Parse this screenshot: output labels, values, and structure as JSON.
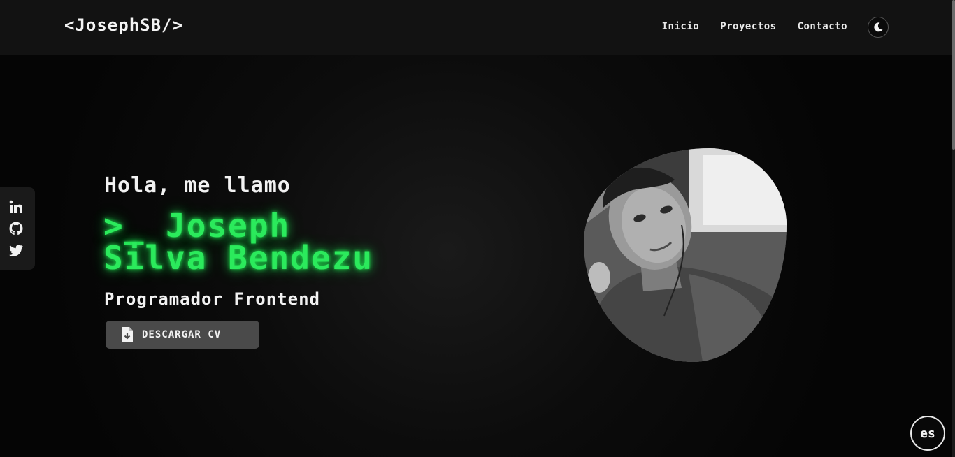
{
  "header": {
    "logo": "<JosephSB/>",
    "nav": [
      {
        "label": "Inicio"
      },
      {
        "label": "Proyectos"
      },
      {
        "label": "Contacto"
      }
    ],
    "theme_toggle_icon": "moon-icon"
  },
  "social": [
    {
      "icon": "linkedin-icon"
    },
    {
      "icon": "github-icon"
    },
    {
      "icon": "twitter-icon"
    }
  ],
  "hero": {
    "greeting": "Hola, me llamo",
    "name_line1": ">_ Joseph",
    "name_line2": "Silva Bendezu",
    "role": "Programador Frontend",
    "cv_button": "DESCARGAR CV",
    "cv_icon": "file-download-icon"
  },
  "lang_button": "es",
  "colors": {
    "accent_green": "#2bea5c",
    "background": "#050505",
    "header": "#121212",
    "button": "#4a4a4a"
  }
}
